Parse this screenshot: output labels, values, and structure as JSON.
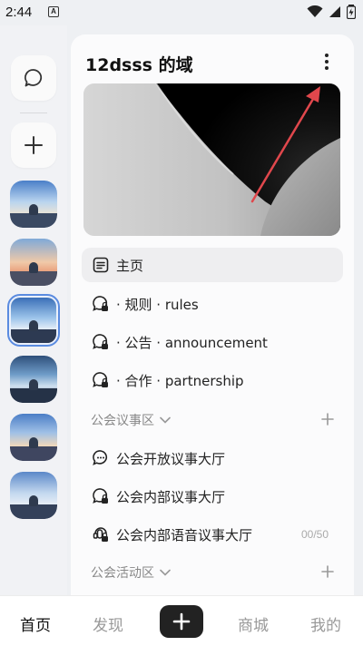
{
  "status_bar": {
    "time": "2:44",
    "notification_icon": "A"
  },
  "server": {
    "name": "12dsss 的域"
  },
  "channels": [
    {
      "label": "主页",
      "icon": "home-page-icon"
    },
    {
      "label": "· 规则 · rules",
      "icon": "chat-locked-icon"
    },
    {
      "label": "· 公告 · announcement",
      "icon": "chat-locked-icon"
    },
    {
      "label": "· 合作 · partnership",
      "icon": "chat-locked-icon"
    }
  ],
  "section_1": {
    "label": "公会议事区",
    "channels": [
      {
        "label": "公会开放议事大厅",
        "icon": "chat-icon"
      },
      {
        "label": "公会内部议事大厅",
        "icon": "chat-locked-icon"
      },
      {
        "label": "公会内部语音议事大厅",
        "icon": "voice-locked-icon",
        "count": "00/50"
      }
    ]
  },
  "section_2": {
    "label": "公会活动区"
  },
  "bottom_nav": {
    "home": "首页",
    "discover": "发现",
    "mall": "商城",
    "mine": "我的"
  },
  "colors": {
    "accent": "#5a8be0",
    "annotation_arrow": "#e0474c"
  }
}
